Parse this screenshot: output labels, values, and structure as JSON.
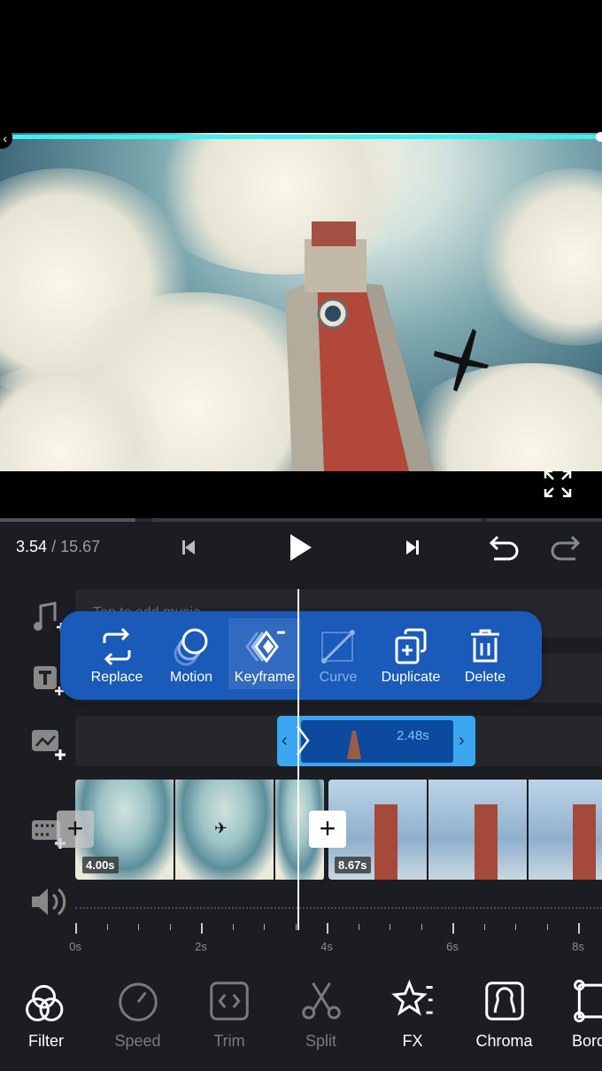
{
  "playback": {
    "current_time": "3.54",
    "total_time": "/ 15.67"
  },
  "tracks": {
    "music_placeholder": "Tap to add music",
    "overlay_duration": "2.48s",
    "clips": [
      {
        "duration": "4.00s"
      },
      {
        "duration": "8.67s"
      }
    ]
  },
  "popup_menu": {
    "items": [
      {
        "label": "Replace",
        "icon": "replace-icon",
        "state": "enabled"
      },
      {
        "label": "Motion",
        "icon": "motion-icon",
        "state": "enabled"
      },
      {
        "label": "Keyframe",
        "icon": "keyframe-icon",
        "state": "selected"
      },
      {
        "label": "Curve",
        "icon": "curve-icon",
        "state": "disabled"
      },
      {
        "label": "Duplicate",
        "icon": "duplicate-icon",
        "state": "enabled"
      },
      {
        "label": "Delete",
        "icon": "trash-icon",
        "state": "enabled"
      }
    ]
  },
  "ruler": {
    "labels": [
      "0s",
      "2s",
      "4s",
      "6s",
      "8s"
    ]
  },
  "toolbar": {
    "items": [
      {
        "label": "Filter",
        "icon": "filter-icon",
        "state": "enabled"
      },
      {
        "label": "Speed",
        "icon": "speed-icon",
        "state": "disabled"
      },
      {
        "label": "Trim",
        "icon": "trim-icon",
        "state": "disabled"
      },
      {
        "label": "Split",
        "icon": "scissors-icon",
        "state": "disabled"
      },
      {
        "label": "FX",
        "icon": "fx-star-icon",
        "state": "enabled"
      },
      {
        "label": "Chroma",
        "icon": "chroma-icon",
        "state": "enabled"
      },
      {
        "label": "Border",
        "icon": "border-icon",
        "state": "enabled"
      }
    ]
  },
  "colors": {
    "accent": "#3ba7f0",
    "popup": "#1a5ab8",
    "seek": "#3ff0f0"
  }
}
